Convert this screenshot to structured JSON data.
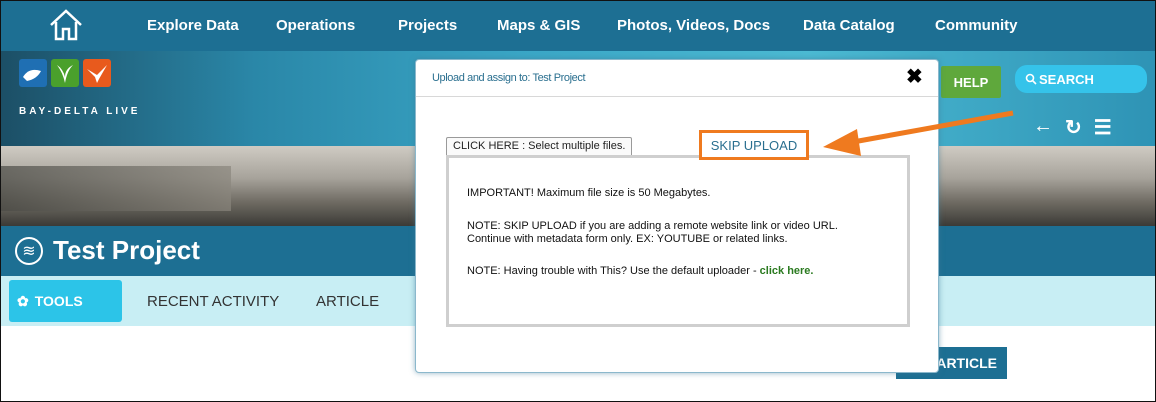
{
  "nav": {
    "items": [
      "Explore Data",
      "Operations",
      "Projects",
      "Maps & GIS",
      "Photos, Videos, Docs",
      "Data Catalog",
      "Community"
    ]
  },
  "header": {
    "logo_text": "BAY-DELTA LIVE",
    "help_label": "HELP",
    "search_label": "SEARCH"
  },
  "project": {
    "title": "Test Project"
  },
  "tabs": {
    "tools_label": "TOOLS",
    "recent_activity_label": "RECENT ACTIVITY",
    "article_label": "ARTICLE"
  },
  "content": {
    "add_article_label": "ARTICLE"
  },
  "modal": {
    "title": "Upload and assign to: Test Project",
    "select_files_label": "CLICK HERE : Select multiple files.",
    "skip_upload_label": "SKIP UPLOAD",
    "note_important": "IMPORTANT! Maximum file size is 50 Megabytes.",
    "note_skip_line1": "NOTE: SKIP UPLOAD if you are adding a remote website link or video URL.",
    "note_skip_line2": "Continue with metadata form only. EX: YOUTUBE or related links.",
    "note_trouble": "NOTE: Having trouble with This? Use the default uploader - ",
    "note_trouble_link": "click here."
  },
  "colors": {
    "nav_bg": "#1d6f93",
    "accent_orange": "#ef7a1f",
    "help_green": "#5fa83c",
    "search_blue": "#35c3ea",
    "tab_bg": "#c8eef4"
  }
}
